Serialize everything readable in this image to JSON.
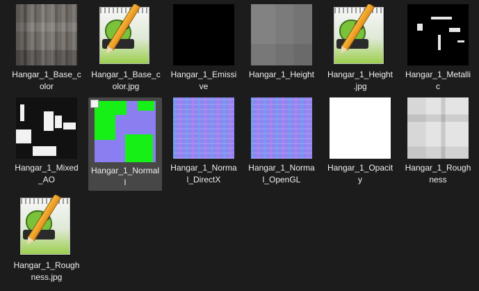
{
  "files": [
    {
      "label": "Hangar_1_Base_c\nolor",
      "thumbnail": "texture-base-color",
      "selected": false
    },
    {
      "label": "Hangar_1_Base_c\nolor.jpg",
      "thumbnail": "notepadpp-file-icon",
      "selected": false
    },
    {
      "label": "Hangar_1_Emissi\nve",
      "thumbnail": "texture-emissive",
      "selected": false
    },
    {
      "label": "Hangar_1_Height",
      "thumbnail": "texture-height",
      "selected": false
    },
    {
      "label": "Hangar_1_Height\n.jpg",
      "thumbnail": "notepadpp-file-icon",
      "selected": false
    },
    {
      "label": "Hangar_1_Metalli\nc",
      "thumbnail": "texture-metallic",
      "selected": false
    },
    {
      "label": "Hangar_1_Mixed\n_AO",
      "thumbnail": "texture-mixed-ao",
      "selected": false
    },
    {
      "label": "Hangar_1_Normal\nl",
      "thumbnail": "texture-normal",
      "selected": true
    },
    {
      "label": "Hangar_1_Norma\nl_DirectX",
      "thumbnail": "texture-normal-directx",
      "selected": false
    },
    {
      "label": "Hangar_1_Norma\nl_OpenGL",
      "thumbnail": "texture-normal-opengl",
      "selected": false
    },
    {
      "label": "Hangar_1_Opacit\ny",
      "thumbnail": "texture-opacity",
      "selected": false
    },
    {
      "label": "Hangar_1_Rough\nness",
      "thumbnail": "texture-roughness",
      "selected": false
    },
    {
      "label": "Hangar_1_Rough\nness.jpg",
      "thumbnail": "notepadpp-file-icon",
      "selected": false
    }
  ],
  "colors": {
    "background": "#1c1c1c",
    "selection": "#474747",
    "text": "#f0f0f0"
  }
}
